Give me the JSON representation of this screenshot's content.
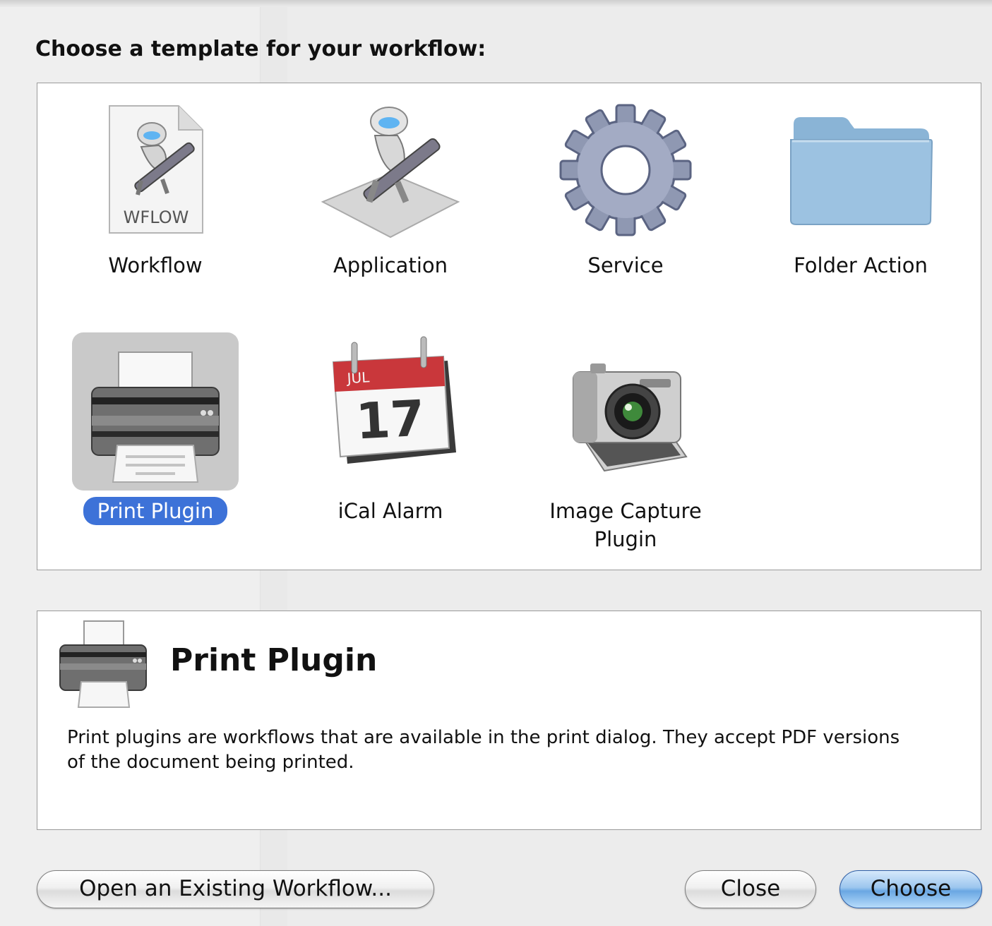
{
  "dialog": {
    "prompt": "Choose a template for your workflow:"
  },
  "templates": [
    {
      "label": "Workflow",
      "icon": "wflow-document-icon",
      "badge": "WFLOW",
      "selected": false
    },
    {
      "label": "Application",
      "icon": "automator-robot-icon",
      "selected": false
    },
    {
      "label": "Service",
      "icon": "gear-icon",
      "selected": false
    },
    {
      "label": "Folder Action",
      "icon": "folder-icon",
      "selected": false
    },
    {
      "label": "Print Plugin",
      "icon": "printer-icon",
      "selected": true
    },
    {
      "label": "iCal Alarm",
      "icon": "calendar-icon",
      "month": "JUL",
      "day": "17",
      "selected": false
    },
    {
      "label": "Image Capture Plugin",
      "label_line1": "Image Capture",
      "label_line2": "Plugin",
      "icon": "camera-icon",
      "selected": false
    }
  ],
  "description": {
    "title": "Print Plugin",
    "text": "Print plugins are workflows that are available in the print dialog. They accept PDF versions of the document being printed."
  },
  "buttons": {
    "open_existing": "Open an Existing Workflow...",
    "close": "Close",
    "choose": "Choose"
  },
  "colors": {
    "selection": "#3d72d8",
    "default_button": "#6aa7e3",
    "window_bg": "#ececec"
  }
}
